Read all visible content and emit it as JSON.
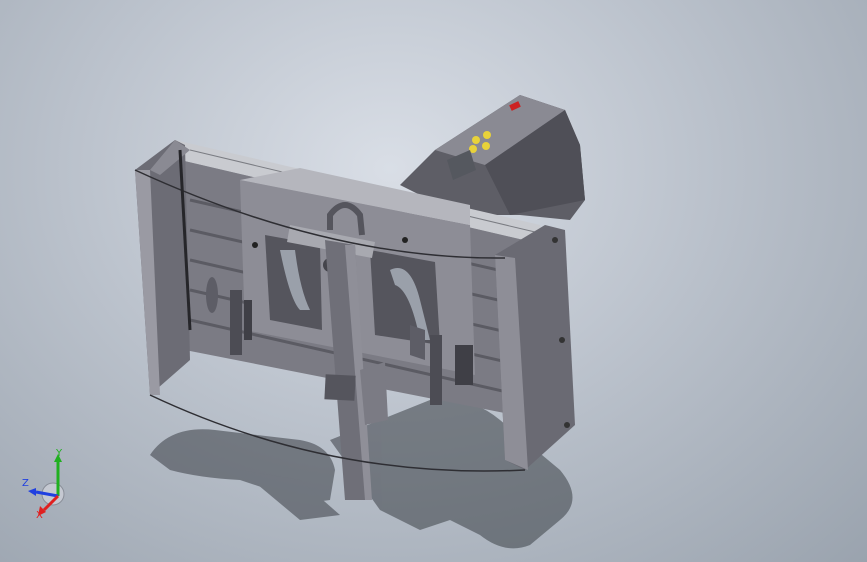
{
  "viewport": {
    "background_top": "#d9dee6",
    "background_bottom": "#9aa3ae"
  },
  "model": {
    "body_color": "#6f6f78",
    "body_dark": "#4a4a52",
    "body_light": "#9a9aa3",
    "rail_color": "#c9cbd0",
    "keypad_color": "#e8d23a",
    "display_color": "#55585f",
    "logo_color": "#cc2222"
  },
  "triad": {
    "x_label": "X",
    "y_label": "Y",
    "z_label": "Z",
    "x_color": "#e02020",
    "y_color": "#20b020",
    "z_color": "#2040e0"
  }
}
